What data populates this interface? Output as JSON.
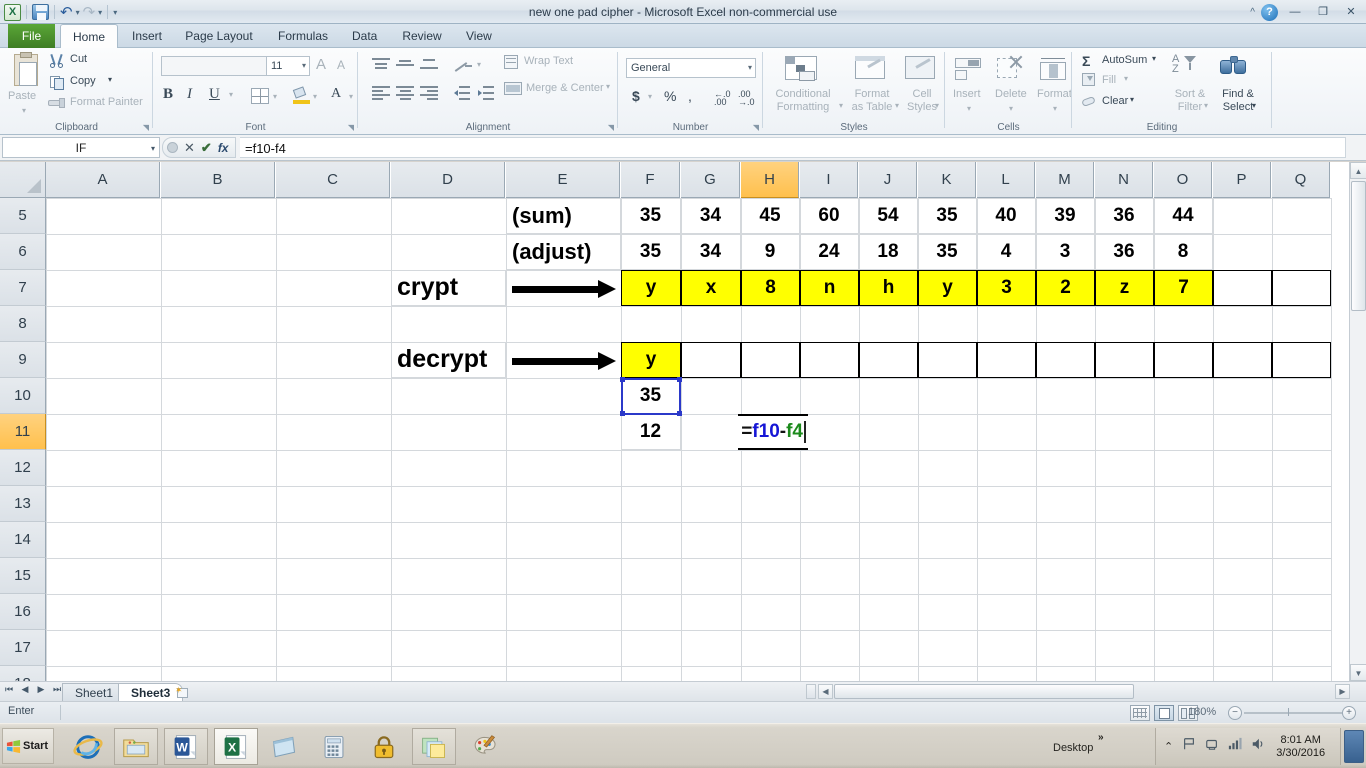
{
  "titlebar": {
    "document_title": "new one pad cipher  -  Microsoft Excel non-commercial use",
    "app_icon": "excel-icon",
    "quick_access": [
      {
        "name": "save-icon",
        "label": "Save"
      },
      {
        "name": "undo-icon",
        "label": "Undo"
      },
      {
        "name": "redo-icon",
        "label": "Redo"
      },
      {
        "name": "customize-qat-icon",
        "label": "Customize Quick Access Toolbar"
      }
    ],
    "window_controls": {
      "collapse_ribbon": "^",
      "help": "?",
      "minimize": "—",
      "restore": "❐",
      "close": "✕"
    }
  },
  "ribbon": {
    "tabs": [
      {
        "label": "File",
        "active": false
      },
      {
        "label": "Home",
        "active": true
      },
      {
        "label": "Insert",
        "active": false
      },
      {
        "label": "Page Layout",
        "active": false
      },
      {
        "label": "Formulas",
        "active": false
      },
      {
        "label": "Data",
        "active": false
      },
      {
        "label": "Review",
        "active": false
      },
      {
        "label": "View",
        "active": false
      }
    ],
    "groups": {
      "clipboard": {
        "label": "Clipboard",
        "paste": "Paste",
        "cut": "Cut",
        "copy": "Copy",
        "format_painter": "Format Painter"
      },
      "font": {
        "label": "Font",
        "font_name": "",
        "font_size": "11",
        "grow_font": "A",
        "shrink_font": "A",
        "bold": "B",
        "italic": "I",
        "underline": "U"
      },
      "alignment": {
        "label": "Alignment",
        "wrap_text": "Wrap Text",
        "merge_center": "Merge & Center"
      },
      "number": {
        "label": "Number",
        "format": "General",
        "currency": "$",
        "percent": "%",
        "comma": ",",
        "increase_decimal": ".00",
        "decrease_decimal": ".00"
      },
      "styles": {
        "label": "Styles",
        "conditional_formatting": "Conditional Formatting",
        "format_as_table": "Format as Table",
        "cell_styles": "Cell Styles"
      },
      "cells": {
        "label": "Cells",
        "insert": "Insert",
        "delete": "Delete",
        "format": "Format"
      },
      "editing": {
        "label": "Editing",
        "autosum": "AutoSum",
        "fill": "Fill",
        "clear": "Clear",
        "sort_filter": "Sort & Filter",
        "find_select": "Find & Select"
      }
    }
  },
  "formula_bar": {
    "name_box": "IF",
    "cancel_icon": "✕",
    "enter_icon": "✔",
    "function_icon": "fx",
    "formula": "=f10-f4"
  },
  "grid": {
    "columns": [
      "A",
      "B",
      "C",
      "D",
      "E",
      "F",
      "G",
      "H",
      "I",
      "J",
      "K",
      "L",
      "M",
      "N",
      "O",
      "P",
      "Q"
    ],
    "selected_column": "H",
    "rows": [
      "5",
      "6",
      "7",
      "8",
      "9",
      "10",
      "11",
      "12",
      "13",
      "14",
      "15",
      "16",
      "17",
      "18"
    ],
    "selected_row": "11",
    "cells": {
      "E5": "(sum)",
      "E6": "(adjust)",
      "D7": "crypt",
      "D9": "decrypt",
      "sum_values": [
        "35",
        "34",
        "45",
        "60",
        "54",
        "35",
        "40",
        "39",
        "36",
        "44"
      ],
      "adjust_values": [
        "35",
        "34",
        "9",
        "24",
        "18",
        "35",
        "4",
        "3",
        "36",
        "8"
      ],
      "crypt_values": [
        "y",
        "x",
        "8",
        "n",
        "h",
        "y",
        "3",
        "2",
        "z",
        "7"
      ],
      "decrypt_values": [
        "y",
        "",
        "",
        "",
        "",
        "",
        "",
        "",
        "",
        ""
      ],
      "F10": "35",
      "F11": "12",
      "H11_editing": {
        "prefix": "=",
        "ref1": "f10",
        "operator": "-",
        "ref2": "f4"
      }
    },
    "highlight_color": "#ffff00",
    "ref1_color": "#1616d6",
    "ref2_color": "#1c8a1c"
  },
  "sheet_tabs": {
    "nav": [
      "⏮",
      "◀",
      "▶",
      "⏭"
    ],
    "tabs": [
      {
        "label": "Sheet1",
        "active": false
      },
      {
        "label": "Sheet3",
        "active": true
      }
    ],
    "insert_sheet_icon": "insert-worksheet-icon"
  },
  "status_bar": {
    "mode": "Enter",
    "view_normal": "normal-view-icon",
    "view_page_layout": "page-layout-view-icon",
    "view_page_break": "page-break-view-icon",
    "zoom": "180%",
    "zoom_out": "−",
    "zoom_in": "+"
  },
  "taskbar": {
    "start_label": "Start",
    "items": [
      {
        "name": "internet-explorer-icon",
        "label": "Internet Explorer"
      },
      {
        "name": "windows-explorer-icon",
        "label": "Windows Explorer"
      },
      {
        "name": "word-icon",
        "label": "Microsoft Word"
      },
      {
        "name": "excel-icon",
        "label": "Microsoft Excel"
      },
      {
        "name": "notepad-icon",
        "label": "Notepad"
      },
      {
        "name": "calculator-icon",
        "label": "Calculator"
      },
      {
        "name": "lock-icon",
        "label": "Security"
      },
      {
        "name": "sticky-notes-icon",
        "label": "Sticky Notes"
      },
      {
        "name": "paint-icon",
        "label": "Paint"
      }
    ],
    "desktop_label": "Desktop",
    "overflow_chevron": "»",
    "tray": {
      "show_hidden": "hidden-icons-icon",
      "flag": "action-center-icon",
      "network_tray": "network-icon",
      "signal": "signal-bars-icon",
      "volume": "volume-icon",
      "time": "8:01 AM",
      "date": "3/30/2016"
    }
  }
}
